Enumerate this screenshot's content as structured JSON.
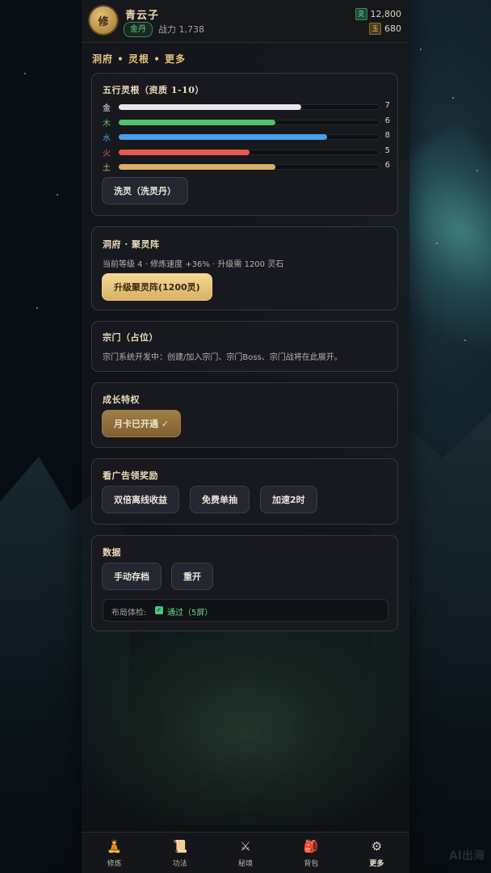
{
  "header": {
    "avatar_char": "修",
    "player_name": "青云子",
    "realm": "金丹",
    "power_label": "战力",
    "power_value": "1,738",
    "currencies": [
      {
        "icon": "灵",
        "value": "12,800"
      },
      {
        "icon": "玉",
        "value": "680"
      }
    ]
  },
  "section_title": "洞府 • 灵根 • 更多",
  "roots_card": {
    "title": "五行灵根（资质 1-10）",
    "elements": [
      {
        "label": "金",
        "value": 7,
        "color": "#e8e8e8",
        "label_color": "#e8e8e8"
      },
      {
        "label": "木",
        "value": 6,
        "color": "#4fc46a",
        "label_color": "#4fc46a"
      },
      {
        "label": "水",
        "value": 8,
        "color": "#4a9fe8",
        "label_color": "#4a9fe8"
      },
      {
        "label": "火",
        "value": 5,
        "color": "#e85a4f",
        "label_color": "#e85a4f"
      },
      {
        "label": "土",
        "value": 6,
        "color": "#d9b065",
        "label_color": "#d9b065"
      }
    ],
    "wash_button": "洗灵（洗灵丹）"
  },
  "cave_card": {
    "title": "洞府 · 聚灵阵",
    "info": "当前等级 4 · 修炼速度 +36% · 升级需 1200 灵石",
    "upgrade_button": "升级聚灵阵(1200灵)"
  },
  "sect_card": {
    "title": "宗门（占位）",
    "info": "宗门系统开发中：创建/加入宗门、宗门Boss、宗门战将在此展开。"
  },
  "growth_card": {
    "title": "成长特权",
    "monthly_button": "月卡已开通 ✓"
  },
  "ads_card": {
    "title": "看广告领奖励",
    "buttons": [
      "双倍离线收益",
      "免费单抽",
      "加速2时"
    ]
  },
  "data_card": {
    "title": "数据",
    "save_button": "手动存档",
    "restart_button": "重开",
    "layout_label": "布局体检:",
    "layout_check": "✓",
    "layout_status": "通过（5屏）"
  },
  "nav": [
    {
      "label": "修炼",
      "icon": "🧘",
      "icon_name": "meditation-icon"
    },
    {
      "label": "功法",
      "icon": "📜",
      "icon_name": "scroll-icon"
    },
    {
      "label": "秘境",
      "icon": "⚔",
      "icon_name": "crossed-swords-icon"
    },
    {
      "label": "背包",
      "icon": "🎒",
      "icon_name": "backpack-icon"
    },
    {
      "label": "更多",
      "icon": "⚙",
      "icon_name": "gear-icon"
    }
  ],
  "active_nav": 4,
  "watermark": "AI出海",
  "theme": {
    "accent": "#e6c27a",
    "success": "#4fc47a"
  }
}
